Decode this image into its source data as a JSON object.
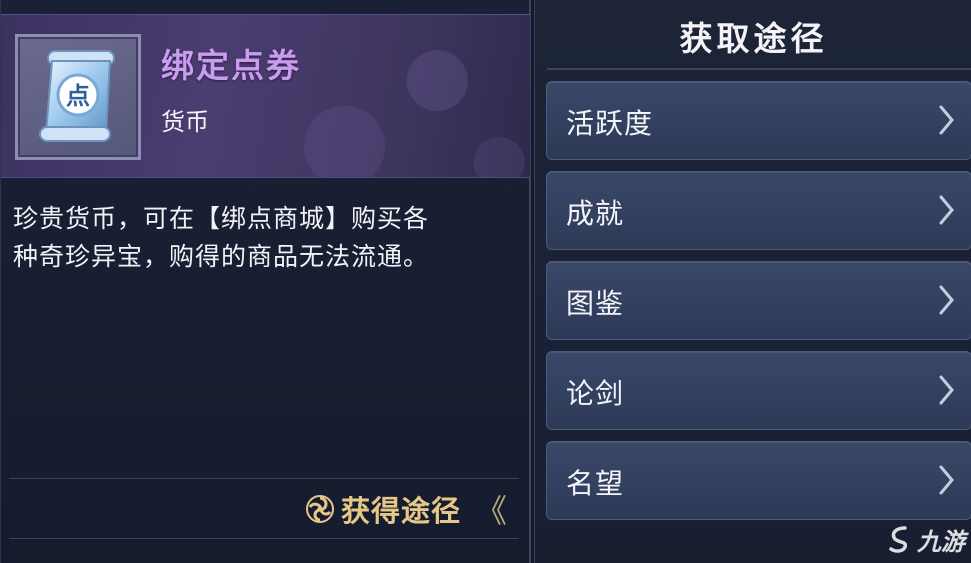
{
  "item": {
    "name": "绑定点券",
    "type": "货币",
    "icon": "bound-coupon-scroll-icon",
    "icon_glyph": "点",
    "description_line1": "珍贵货币，可在【绑点商城】购买各",
    "description_line2": "种奇珍异宝，购得的商品无法流通。",
    "name_color": "#c99cf2"
  },
  "acquire": {
    "label": "获得途径",
    "arrows": "《",
    "label_color": "#e7c787"
  },
  "sources": {
    "title": "获取途径",
    "items": [
      {
        "label": "活跃度"
      },
      {
        "label": "成就"
      },
      {
        "label": "图鉴"
      },
      {
        "label": "论剑"
      },
      {
        "label": "名望"
      }
    ]
  },
  "watermark": {
    "text": "九游"
  }
}
